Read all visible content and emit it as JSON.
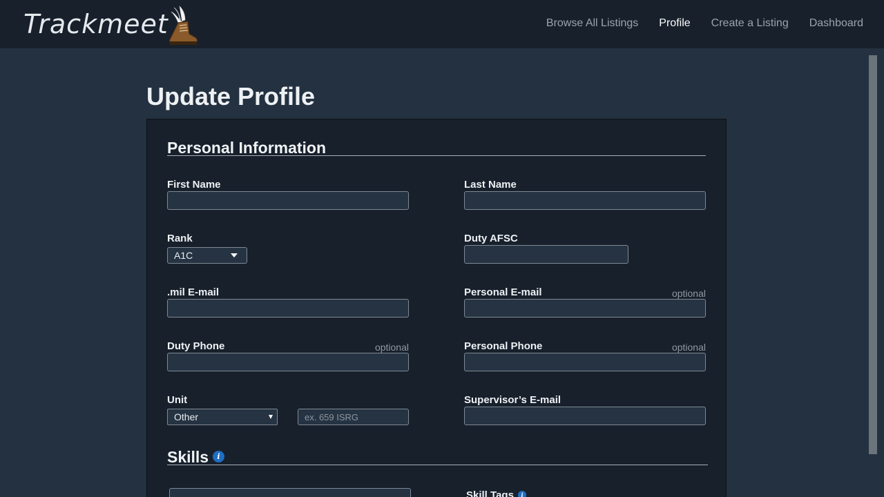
{
  "app": {
    "brand": "Trackmeet",
    "nav": [
      {
        "label": "Browse All Listings",
        "active": false
      },
      {
        "label": "Profile",
        "active": true
      },
      {
        "label": "Create a Listing",
        "active": false
      },
      {
        "label": "Dashboard",
        "active": false
      }
    ]
  },
  "page": {
    "title": "Update Profile"
  },
  "personal": {
    "section_title": "Personal Information",
    "first_name": {
      "label": "First Name",
      "value": ""
    },
    "last_name": {
      "label": "Last Name",
      "value": ""
    },
    "rank": {
      "label": "Rank",
      "selected": "A1C"
    },
    "duty_afsc": {
      "label": "Duty AFSC",
      "value": ""
    },
    "mil_email": {
      "label": ".mil E-mail",
      "value": ""
    },
    "personal_email": {
      "label": "Personal E-mail",
      "optional": "optional",
      "value": ""
    },
    "duty_phone": {
      "label": "Duty Phone",
      "optional": "optional",
      "value": ""
    },
    "personal_phone": {
      "label": "Personal Phone",
      "optional": "optional",
      "value": ""
    },
    "unit": {
      "label": "Unit",
      "selected": "Other",
      "other_placeholder": "ex. 659 ISRG"
    },
    "supervisor_email": {
      "label": "Supervisor’s E-mail",
      "value": ""
    }
  },
  "skills": {
    "section_title": "Skills",
    "info_glyph": "i",
    "skill_tags_label": "Skill Tags",
    "icons": [
      "info-icon"
    ]
  },
  "colors": {
    "background": "#243140",
    "header": "#17202b",
    "card": "#17202b",
    "input_bg": "#253342",
    "info_blue": "#1f6ec4"
  }
}
